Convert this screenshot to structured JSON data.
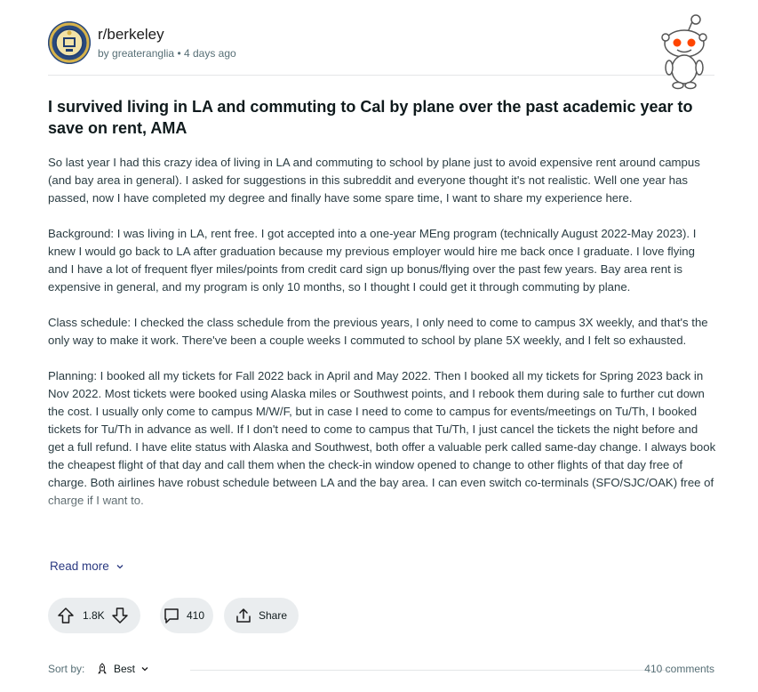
{
  "post": {
    "subreddit": "r/berkeley",
    "author_prefix": "by",
    "author": "greateranglia",
    "separator": "•",
    "age": "4 days ago",
    "title": "I survived living in LA and commuting to Cal by plane over the past academic year to save on rent, AMA",
    "paragraphs": [
      "So last year I had this crazy idea of living in LA and commuting to school by plane just to avoid expensive rent around campus (and bay area in general). I asked for suggestions in this subreddit and everyone thought it's not realistic. Well one year has passed, now I have completed my degree and finally have some spare time, I want to share my experience here.",
      "Background: I was living in LA, rent free. I got accepted into a one-year MEng program (technically August 2022-May 2023). I knew I would go back to LA after graduation because my previous employer would hire me back once I graduate. I love flying and I have a lot of frequent flyer miles/points from credit card sign up bonus/flying over the past few years. Bay area rent is expensive in general, and my program is only 10 months, so I thought I could get it through commuting by plane.",
      "Class schedule: I checked the class schedule from the previous years, I only need to come to campus 3X weekly, and that's the only way to make it work. There've been a couple weeks I commuted to school by plane 5X weekly, and I felt so exhausted.",
      "Planning: I booked all my tickets for Fall 2022 back in April and May 2022. Then I booked all my tickets for Spring 2023 back in Nov 2022. Most tickets were booked using Alaska miles or Southwest points, and I rebook them during sale to further cut down the cost. I usually only come to campus M/W/F, but in case I need to come to campus for events/meetings on Tu/Th, I booked tickets for Tu/Th in advance as well. If I don't need to come to campus that Tu/Th, I just cancel the tickets the night before and get a full refund. I have elite status with Alaska and Southwest, both offer a valuable perk called same-day change. I always book the cheapest flight of that day and call them when the check-in window opened to change to other flights of that day free of charge. Both airlines have robust schedule between LA and the bay area. I can even switch co-terminals (SFO/SJC/OAK) free of charge if I want to."
    ],
    "read_more": "Read more",
    "votes": "1.8K",
    "comments": "410",
    "share": "Share"
  },
  "sort": {
    "label": "Sort by:",
    "value": "Best",
    "comments_count": "410 comments"
  },
  "icons": {
    "avatar": "subreddit-seal-icon",
    "mascot": "snoo-mascot-icon",
    "upvote": "upvote-arrow-icon",
    "downvote": "downvote-arrow-icon",
    "comment": "comment-bubble-icon",
    "share": "share-icon",
    "sort": "rocket-icon",
    "chevron": "chevron-down-icon"
  },
  "colors": {
    "link": "#2a3981",
    "pill": "#eaedef",
    "muted": "#576f76",
    "text": "#2a3c42"
  }
}
